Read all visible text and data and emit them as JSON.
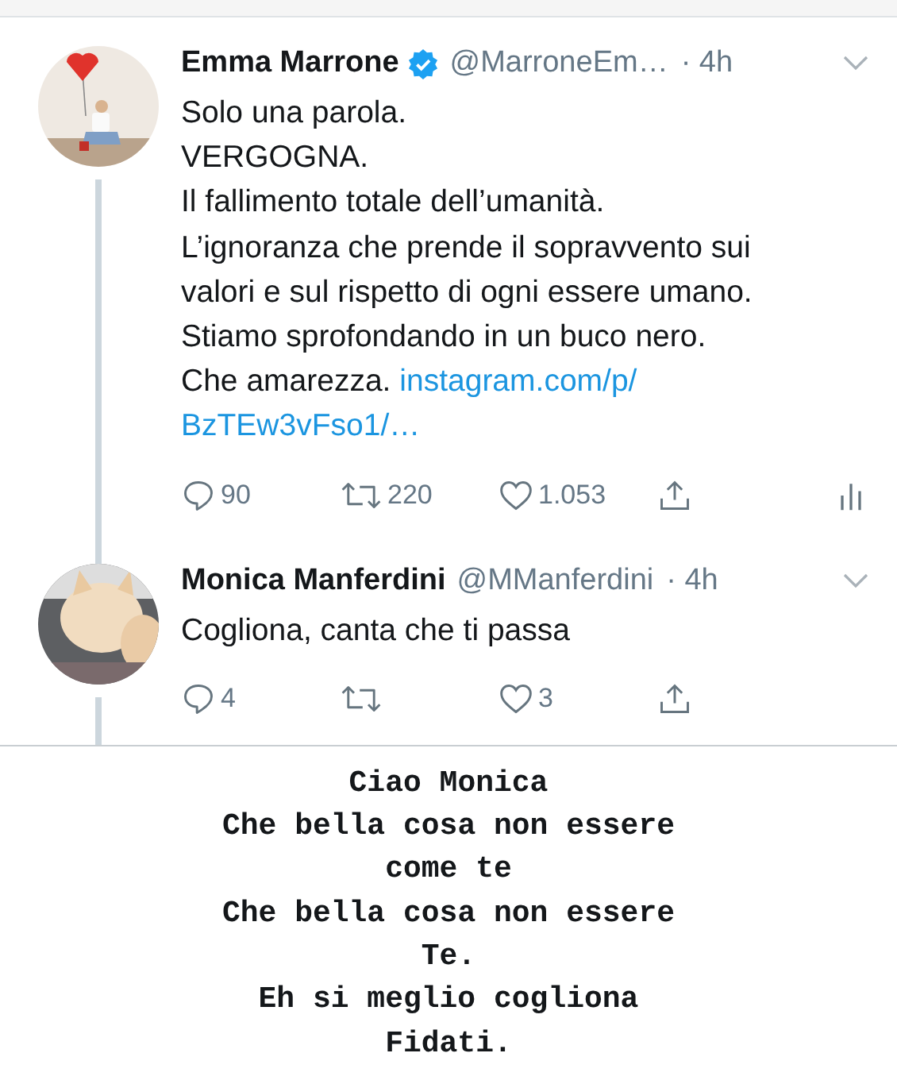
{
  "tweets": [
    {
      "name": "Emma Marrone",
      "verified": true,
      "handle": "@MarroneEm…",
      "time": "· 4h",
      "text": [
        "Solo una parola.",
        "VERGOGNA.",
        "Il fallimento totale dell’umanità.",
        "L’ignoranza che prende il sopravvento sui",
        "valori e sul rispetto di ogni essere umano.",
        "Stiamo sprofondando in un buco nero.",
        "Che amarezza. "
      ],
      "link": [
        "instagram.com/p/",
        "BzTEw3vFso1/…"
      ],
      "actions": [
        {
          "kind": "reply",
          "count": "90"
        },
        {
          "kind": "retweet",
          "count": "220"
        },
        {
          "kind": "like",
          "count": "1.053"
        },
        {
          "kind": "share"
        },
        {
          "kind": "analytics"
        }
      ]
    },
    {
      "name": "Monica Manferdini",
      "verified": false,
      "handle": "@MManferdini",
      "time": "· 4h",
      "text": [
        "Cogliona, canta che ti passa"
      ],
      "actions": [
        {
          "kind": "reply",
          "count": "4"
        },
        {
          "kind": "retweet"
        },
        {
          "kind": "like",
          "count": "3"
        },
        {
          "kind": "share"
        }
      ]
    }
  ],
  "caption": [
    "Ciao Monica",
    "Che bella cosa non essere",
    "come te",
    "Che bella cosa non essere",
    "Te.",
    "Eh si meglio cogliona",
    "Fidati."
  ]
}
